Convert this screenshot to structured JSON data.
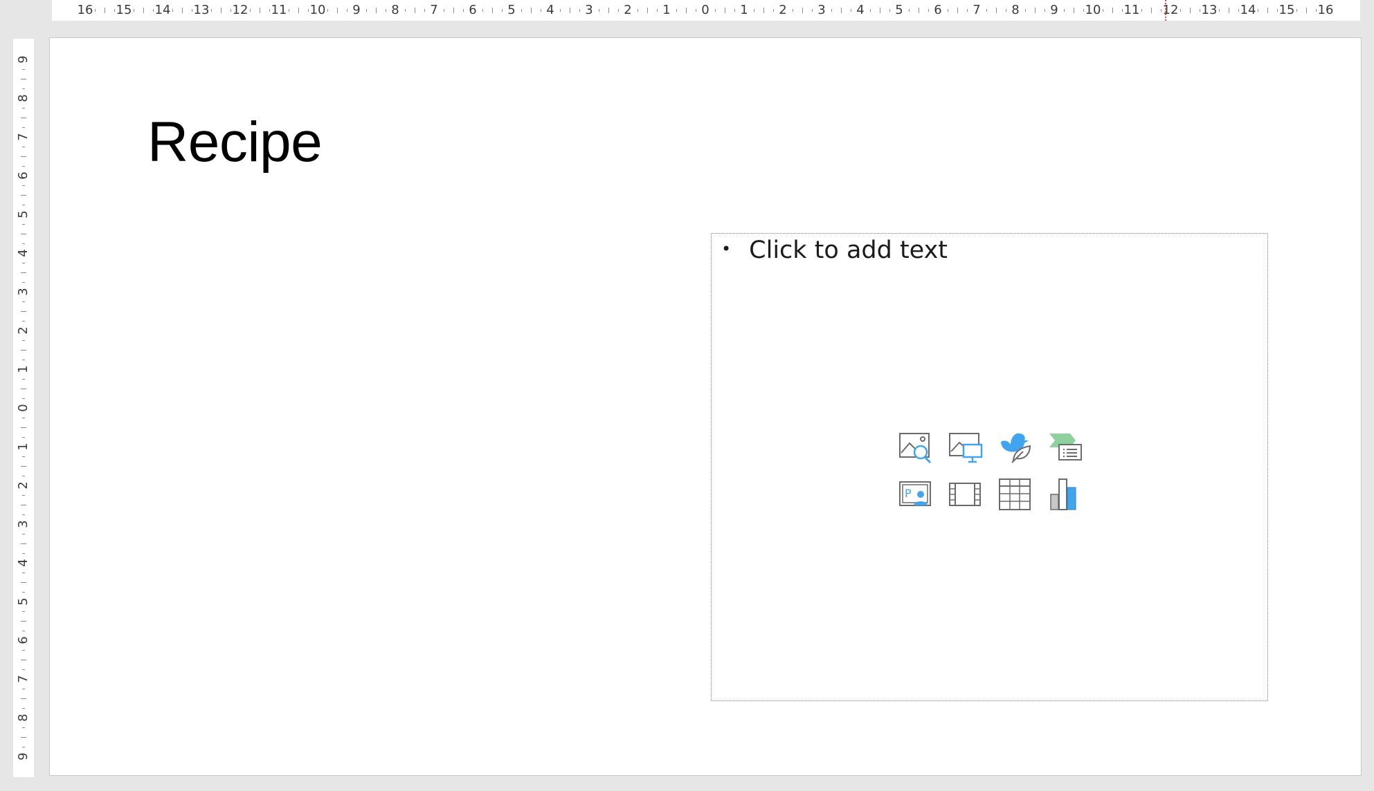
{
  "horizontal_ruler": {
    "labels": [
      "16",
      "15",
      "14",
      "13",
      "12",
      "11",
      "10",
      "9",
      "8",
      "7",
      "6",
      "5",
      "4",
      "3",
      "2",
      "1",
      "0",
      "1",
      "2",
      "3",
      "4",
      "5",
      "6",
      "7",
      "8",
      "9",
      "10",
      "11",
      "12",
      "13",
      "14",
      "15",
      "16"
    ]
  },
  "vertical_ruler": {
    "labels": [
      "9",
      "8",
      "7",
      "6",
      "5",
      "4",
      "3",
      "2",
      "1",
      "0",
      "1",
      "2",
      "3",
      "4",
      "5",
      "6",
      "7",
      "8",
      "9"
    ]
  },
  "slide": {
    "title": "Recipe",
    "content_placeholder": {
      "bullet": "•",
      "text": "Click to add text",
      "insert_icons": [
        {
          "name": "stock-images-icon"
        },
        {
          "name": "pictures-icon"
        },
        {
          "name": "icons-icon"
        },
        {
          "name": "smartart-icon"
        },
        {
          "name": "cameo-icon"
        },
        {
          "name": "video-icon"
        },
        {
          "name": "table-icon"
        },
        {
          "name": "chart-icon"
        }
      ]
    }
  },
  "colors": {
    "accent_blue": "#41a5ee",
    "accent_green": "#8fd19e",
    "icon_gray": "#6b6b6b"
  }
}
